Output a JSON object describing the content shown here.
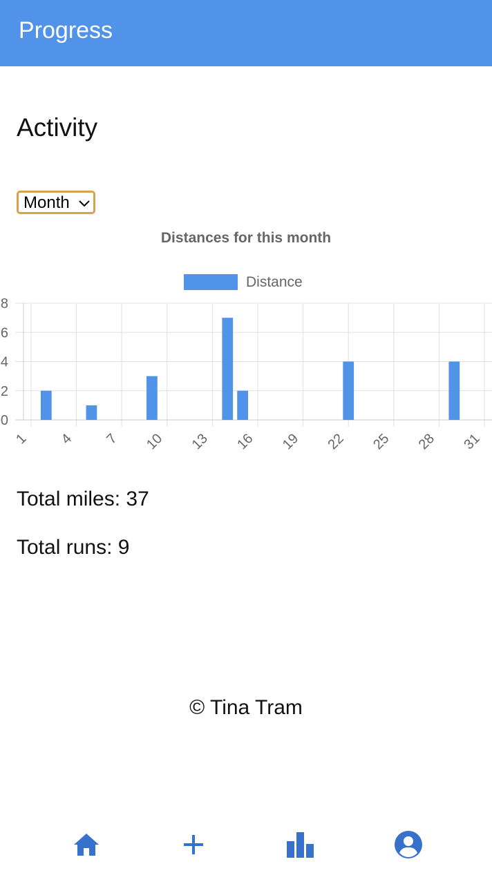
{
  "app_bar": {
    "title": "Progress"
  },
  "section": {
    "heading": "Activity"
  },
  "range_select": {
    "selected": "Month"
  },
  "stats": {
    "total_miles_text": "Total miles: 37",
    "total_runs_text": "Total runs: 9"
  },
  "footer": {
    "copyright": "© Tina Tram"
  },
  "bottom_nav": {
    "items": [
      {
        "icon": "home-icon"
      },
      {
        "icon": "plus-icon"
      },
      {
        "icon": "bar-chart-icon"
      },
      {
        "icon": "account-circle-icon"
      }
    ]
  },
  "colors": {
    "app_bar": "#5093e8",
    "bar_fill": "#5093e8",
    "nav_icon": "#3672cc",
    "select_border": "#d9a24a"
  },
  "chart_data": {
    "type": "bar",
    "title": "Distances for this month",
    "legend": {
      "position": "top",
      "entries": [
        "Distance"
      ]
    },
    "categories": [
      1,
      2,
      3,
      4,
      5,
      6,
      7,
      8,
      9,
      10,
      11,
      12,
      13,
      14,
      15,
      16,
      17,
      18,
      19,
      20,
      21,
      22,
      23,
      24,
      25,
      26,
      27,
      28,
      29,
      30,
      31
    ],
    "x_tick_labels": [
      "1",
      "4",
      "7",
      "10",
      "13",
      "16",
      "19",
      "22",
      "25",
      "28",
      "31"
    ],
    "series": [
      {
        "name": "Distance",
        "values": [
          0,
          2,
          0,
          0,
          1,
          0,
          0,
          0,
          3,
          0,
          0,
          0,
          0,
          7,
          2,
          0,
          0,
          0,
          0,
          0,
          0,
          4,
          0,
          0,
          0,
          0,
          0,
          0,
          4,
          0,
          0
        ]
      }
    ],
    "y_ticks": [
      "0",
      "2",
      "4",
      "6",
      "8"
    ],
    "ylim": [
      0,
      8
    ],
    "grid": true
  }
}
